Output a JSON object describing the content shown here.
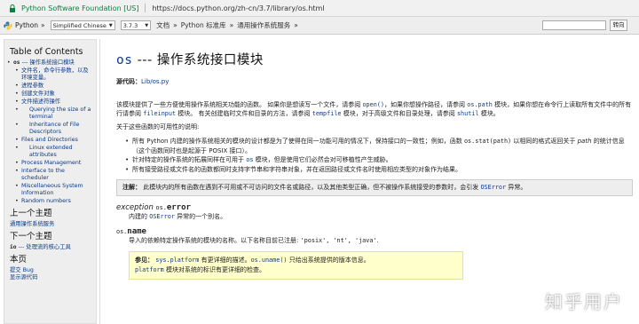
{
  "urlbar": {
    "secure_label": "Python Software Foundation [US]",
    "url": "https://docs.python.org/zh-cn/3.7/library/os.html"
  },
  "relbar": {
    "site": "Python",
    "language": "Simplified Chinese",
    "version": "3.7.3",
    "crumb1": "文档",
    "crumb2": "Python 标准库",
    "crumb3": "通用操作系统服务",
    "go_label": "转向"
  },
  "sidebar": {
    "toc_title": "Table of Contents",
    "items": [
      {
        "level": 1,
        "code": "os",
        "text": " --- 操作系统接口模块"
      },
      {
        "level": 2,
        "text": "文件名，命令行参数，以及环境变量。"
      },
      {
        "level": 2,
        "text": "进程参数"
      },
      {
        "level": 2,
        "text": "创建文件对象"
      },
      {
        "level": 2,
        "text": "文件描述符操作"
      },
      {
        "level": 3,
        "text": "Querying the size of a terminal"
      },
      {
        "level": 3,
        "text": "Inheritance of File Descriptors"
      },
      {
        "level": 2,
        "text": "Files and Directories"
      },
      {
        "level": 3,
        "text": "Linux extended attributes"
      },
      {
        "level": 2,
        "text": "Process Management"
      },
      {
        "level": 2,
        "text": "Interface to the scheduler"
      },
      {
        "level": 2,
        "text": "Miscellaneous System Information"
      },
      {
        "level": 2,
        "text": "Random numbers"
      }
    ],
    "prev_title": "上一个主题",
    "prev_link": "通用操作系统服务",
    "next_title": "下一个主题",
    "next_code": "io",
    "next_text": " --- 处理流的核心工具",
    "this_page": "本页",
    "report_bug": "提交 Bug",
    "show_source": "显示源代码"
  },
  "main": {
    "title_code": "os",
    "title_text": " --- 操作系统接口模块",
    "source_label": "源代码：",
    "source_link": "Lib/os.py",
    "intro_1": "该模块提供了一些方便使用操作系统相关功能的函数。 如果你是想读写一个文件，请参阅 ",
    "intro_open": "open()",
    "intro_2": "，如果你想操作路径，请参阅 ",
    "intro_ospath": "os.path",
    "intro_3": " 模块，如果你想在命令行上读取所有文件中的所有行请参阅 ",
    "intro_fileinput": "fileinput",
    "intro_4": " 模块。 有关创建临时文件和目录的方法，请参阅 ",
    "intro_tempfile": "tempfile",
    "intro_5": " 模块，对于高级文件和目录处理，请参阅 ",
    "intro_shutil": "shutil",
    "intro_6": " 模块。",
    "avail": "关于这些函数的可用性的说明:",
    "bullet1_a": "所有 Python 内建的操作系统相关的模块的设计都是为了使得在同一功能可用的情况下，保持接口的一致性；例如，函数 ",
    "bullet1_code": "os.stat(path)",
    "bullet1_b": " 以相同的格式返回关于 ",
    "bullet1_path": "path",
    "bullet1_c": " 的统计信息（这个函数同时也是起源于 POSIX 接口）。",
    "bullet2_a": "针对特定的操作系统的拓展同样在可用于 ",
    "bullet2_code": "os",
    "bullet2_b": " 模块，但是使用它们必然会对可移植性产生威胁。",
    "bullet3": "所有接受路径或文件名的函数都同时支持字节串和字符串对象，并在返回路径或文件名时使用相应类型的对象作为结果。",
    "note_label": "注解：",
    "note_a": " 此模块内的所有函数在遇到不可用或不可访问的文件名或路径，以及其他类型正确，但不被操作系统接受的参数时，会引发 ",
    "note_code": "OSError",
    "note_b": " 异常。",
    "exc_kw": "exception",
    "exc_prefix": "os.",
    "exc_name": "error",
    "exc_desc_a": "内建的 ",
    "exc_desc_code": "OSError",
    "exc_desc_b": " 异常的一个别名。",
    "name_prefix": "os.",
    "name_name": "name",
    "name_desc_a": "导入的依赖特定操作系统的模块的名称。以下名称目前已注册: ",
    "name_desc_codes": "'posix', 'nt', 'java'",
    "name_desc_b": ".",
    "see_label": "参见：",
    "see_code1": "sys.platform",
    "see_a": " 有更详细的描述。",
    "see_code2": "os.uname()",
    "see_b": " 只给出系统提供的版本信息。",
    "see_code3": "platform",
    "see_c": " 模块对系统的标识有更详细的检查。"
  },
  "watermark": "知乎用户"
}
